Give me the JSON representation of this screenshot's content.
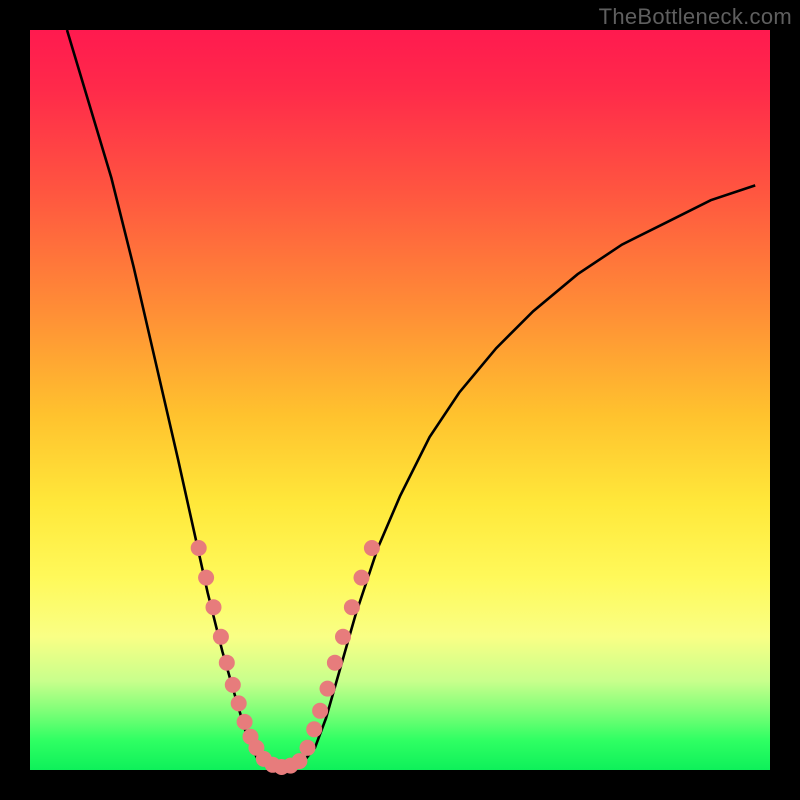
{
  "watermark": "TheBottleneck.com",
  "colors": {
    "dot_fill": "#e77c7c",
    "curve_stroke": "#000000",
    "gradient_top": "#ff1a4f",
    "gradient_bottom": "#0ef05a"
  },
  "chart_data": {
    "type": "line",
    "title": "",
    "xlabel": "",
    "ylabel": "",
    "xlim": [
      0,
      100
    ],
    "ylim": [
      0,
      100
    ],
    "grid": false,
    "legend": false,
    "curve": [
      {
        "x": 5,
        "y": 100
      },
      {
        "x": 8,
        "y": 90
      },
      {
        "x": 11,
        "y": 80
      },
      {
        "x": 14,
        "y": 68
      },
      {
        "x": 17,
        "y": 55
      },
      {
        "x": 20,
        "y": 42
      },
      {
        "x": 22,
        "y": 33
      },
      {
        "x": 24,
        "y": 24
      },
      {
        "x": 26,
        "y": 16
      },
      {
        "x": 28,
        "y": 9
      },
      {
        "x": 29.5,
        "y": 4
      },
      {
        "x": 31,
        "y": 1
      },
      {
        "x": 32.5,
        "y": 0.3
      },
      {
        "x": 34,
        "y": 0.1
      },
      {
        "x": 35.5,
        "y": 0.3
      },
      {
        "x": 37,
        "y": 1.2
      },
      {
        "x": 38.5,
        "y": 3
      },
      {
        "x": 40,
        "y": 7
      },
      {
        "x": 42,
        "y": 14
      },
      {
        "x": 44,
        "y": 21
      },
      {
        "x": 47,
        "y": 30
      },
      {
        "x": 50,
        "y": 37
      },
      {
        "x": 54,
        "y": 45
      },
      {
        "x": 58,
        "y": 51
      },
      {
        "x": 63,
        "y": 57
      },
      {
        "x": 68,
        "y": 62
      },
      {
        "x": 74,
        "y": 67
      },
      {
        "x": 80,
        "y": 71
      },
      {
        "x": 86,
        "y": 74
      },
      {
        "x": 92,
        "y": 77
      },
      {
        "x": 98,
        "y": 79
      }
    ],
    "dots_left": [
      {
        "x": 22.8,
        "y": 30
      },
      {
        "x": 23.8,
        "y": 26
      },
      {
        "x": 24.8,
        "y": 22
      },
      {
        "x": 25.8,
        "y": 18
      },
      {
        "x": 26.6,
        "y": 14.5
      },
      {
        "x": 27.4,
        "y": 11.5
      },
      {
        "x": 28.2,
        "y": 9
      },
      {
        "x": 29.0,
        "y": 6.5
      },
      {
        "x": 29.8,
        "y": 4.5
      },
      {
        "x": 30.6,
        "y": 3
      }
    ],
    "dots_bottom": [
      {
        "x": 31.6,
        "y": 1.5
      },
      {
        "x": 32.8,
        "y": 0.7
      },
      {
        "x": 34.0,
        "y": 0.4
      },
      {
        "x": 35.2,
        "y": 0.6
      },
      {
        "x": 36.4,
        "y": 1.2
      }
    ],
    "dots_right": [
      {
        "x": 37.5,
        "y": 3
      },
      {
        "x": 38.4,
        "y": 5.5
      },
      {
        "x": 39.2,
        "y": 8
      },
      {
        "x": 40.2,
        "y": 11
      },
      {
        "x": 41.2,
        "y": 14.5
      },
      {
        "x": 42.3,
        "y": 18
      },
      {
        "x": 43.5,
        "y": 22
      },
      {
        "x": 44.8,
        "y": 26
      },
      {
        "x": 46.2,
        "y": 30
      }
    ]
  }
}
